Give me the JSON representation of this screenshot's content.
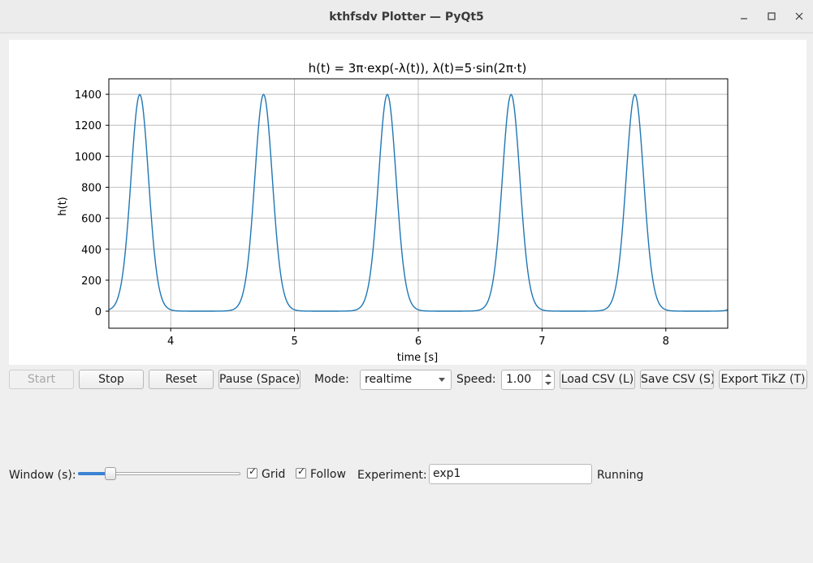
{
  "window": {
    "title": "kthfsdv Plotter — PyQt5",
    "controls": {
      "minimize_icon": "minimize-icon",
      "maximize_icon": "maximize-icon",
      "close_icon": "close-icon"
    }
  },
  "chart_data": {
    "type": "line",
    "title": "h(t) = 3π·exp(-λ(t)), λ(t)=5·sin(2π·t)",
    "xlabel": "time [s]",
    "ylabel": "h(t)",
    "xlim": [
      3.5,
      8.5
    ],
    "ylim": [
      -110,
      1500
    ],
    "xticks": [
      4,
      5,
      6,
      7,
      8
    ],
    "yticks": [
      0,
      200,
      400,
      600,
      800,
      1000,
      1200,
      1400
    ],
    "grid": true,
    "series": [
      {
        "color": "#1f77b4",
        "function": "3*pi*exp(-5*sin(2*pi*t))",
        "x_range": [
          3.5,
          8.5
        ]
      }
    ]
  },
  "toolbar": {
    "start_label": "Start",
    "stop_label": "Stop",
    "reset_label": "Reset",
    "pause_label": "Pause (Space)",
    "mode_label": "Mode:",
    "mode_value": "realtime",
    "speed_label": "Speed:",
    "speed_value": "1.00",
    "load_label": "Load CSV (L)",
    "save_label": "Save CSV (S)",
    "export_label": "Export TikZ (T)"
  },
  "bottom": {
    "window_label": "Window (s):",
    "window_slider_fraction": 0.18,
    "grid_label": "Grid",
    "grid_checked": true,
    "follow_label": "Follow",
    "follow_checked": true,
    "experiment_label": "Experiment:",
    "experiment_value": "exp1",
    "status": "Running"
  },
  "colors": {
    "line": "#1f77b4",
    "grid": "#b0b0b0",
    "background": "#efefef"
  }
}
